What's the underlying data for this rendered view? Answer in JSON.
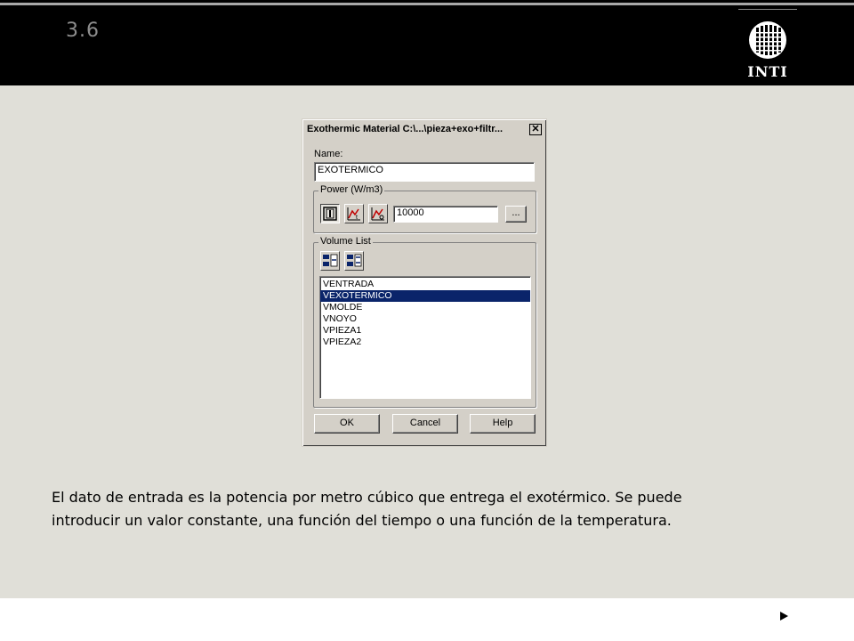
{
  "slide": {
    "number": "3.6"
  },
  "logo": {
    "text": "INTI"
  },
  "dialog": {
    "title": "Exothermic Material C:\\...\\pieza+exo+filtr...",
    "close_glyph": "✕",
    "name_label": "Name:",
    "name_value": "EXOTERMICO",
    "power_group": "Power (W/m3)",
    "power_value": "10000",
    "browse_label": "...",
    "power_modes": [
      "constant-icon",
      "time-function-icon",
      "temperature-function-icon"
    ],
    "volume_group": "Volume List",
    "volume_buttons": [
      "add-volume-icon",
      "remove-volume-icon"
    ],
    "volumes": [
      "VENTRADA",
      "VEXOTERMICO",
      "VMOLDE",
      "VNOYO",
      "VPIEZA1",
      "VPIEZA2"
    ],
    "selected_volume": "VEXOTERMICO",
    "ok_label": "OK",
    "cancel_label": "Cancel",
    "help_label": "Help"
  },
  "caption": {
    "line1": "El dato de entrada es la potencia por metro cúbico que entrega el exotérmico. Se puede",
    "line2": "introducir un valor constante, una función del tiempo o una función de la temperatura."
  },
  "colors": {
    "selection": "#0a246a",
    "dialog_face": "#d4d0c8",
    "slide_bg": "#e0dfd8"
  }
}
